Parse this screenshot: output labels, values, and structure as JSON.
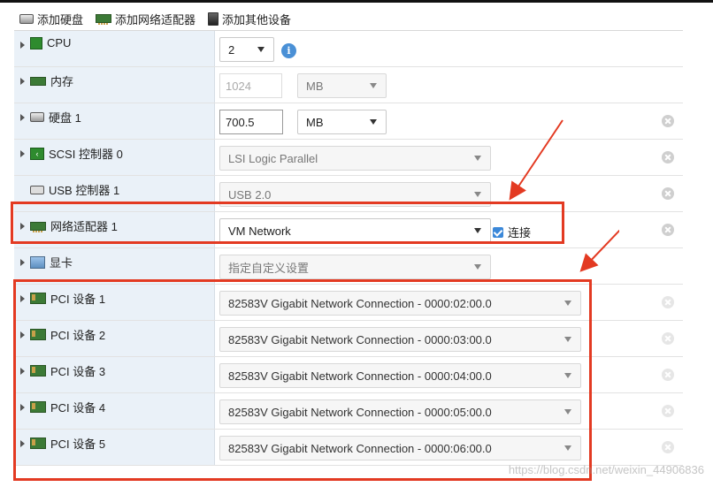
{
  "toolbar": {
    "add_disk": "添加硬盘",
    "add_nic": "添加网络适配器",
    "add_other": "添加其他设备"
  },
  "rows": {
    "cpu": {
      "label": "CPU",
      "value": "2"
    },
    "memory": {
      "label": "内存",
      "value": "1024",
      "unit": "MB"
    },
    "disk": {
      "label": "硬盘 1",
      "value": "700.5",
      "unit": "MB"
    },
    "scsi": {
      "label": "SCSI 控制器 0",
      "value": "LSI Logic Parallel"
    },
    "usb": {
      "label": "USB 控制器 1",
      "value": "USB 2.0"
    },
    "nic": {
      "label": "网络适配器 1",
      "value": "VM Network",
      "connect_label": "连接",
      "connected": true
    },
    "display": {
      "label": "显卡",
      "value": "指定自定义设置"
    },
    "pci": [
      {
        "label": "PCI 设备 1",
        "value": "82583V Gigabit Network Connection - 0000:02:00.0"
      },
      {
        "label": "PCI 设备 2",
        "value": "82583V Gigabit Network Connection - 0000:03:00.0"
      },
      {
        "label": "PCI 设备 3",
        "value": "82583V Gigabit Network Connection - 0000:04:00.0"
      },
      {
        "label": "PCI 设备 4",
        "value": "82583V Gigabit Network Connection - 0000:05:00.0"
      },
      {
        "label": "PCI 设备 5",
        "value": "82583V Gigabit Network Connection - 0000:06:00.0"
      }
    ]
  },
  "watermark": "https://blog.csdn.net/weixin_44906836",
  "colors": {
    "highlight": "#e33a22",
    "label_bg": "#eaf1f8",
    "info_blue": "#4a90d6"
  }
}
